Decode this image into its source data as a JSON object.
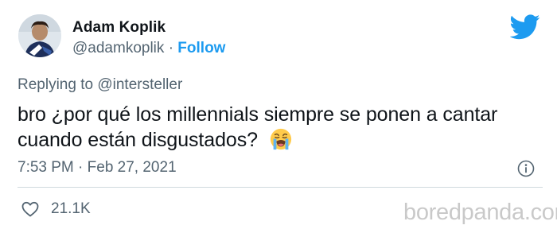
{
  "author": {
    "display_name": "Adam Koplik",
    "handle": "@adamkoplik",
    "separator": "·",
    "follow_label": "Follow"
  },
  "reply": {
    "prefix": "Replying to",
    "mention": "@intersteller"
  },
  "tweet": {
    "text": "bro ¿por qué los millennials siempre se ponen a cantar cuando están disgustados?",
    "emoji": "loudly-crying-face-emoji"
  },
  "meta": {
    "time": "7:53 PM",
    "separator": "·",
    "date": "Feb 27, 2021",
    "like_count": "21.1K"
  },
  "watermark": "boredpanda.com",
  "colors": {
    "accent": "#1d9bf0",
    "secondary_text": "#536471",
    "divider": "#cfd9de",
    "watermark": "#c9c9c9"
  }
}
